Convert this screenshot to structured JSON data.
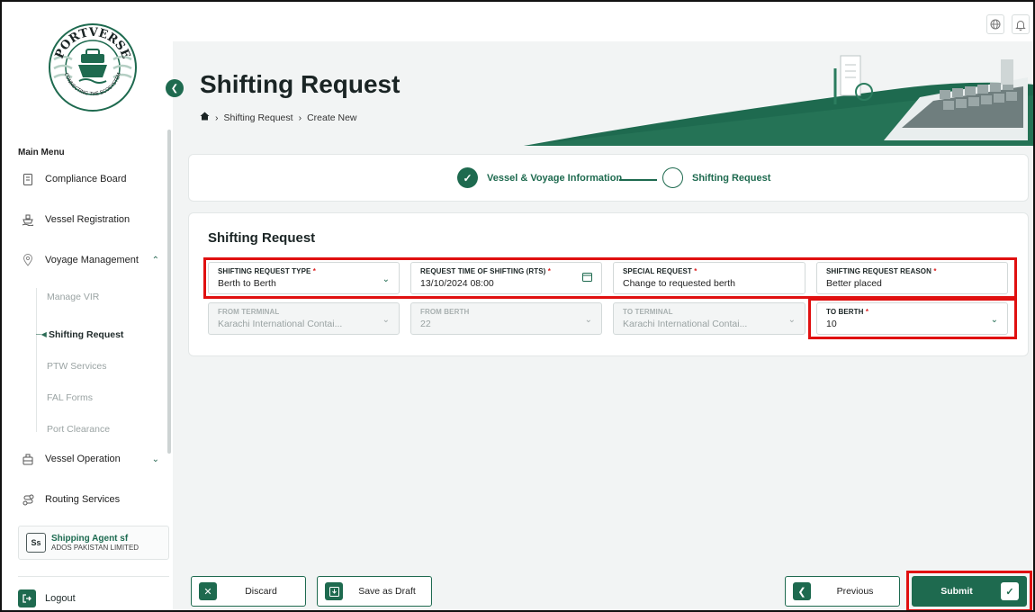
{
  "brand": {
    "name": "PORTVERSE",
    "tagline": "CONNECTING THE ECOSYSTEM"
  },
  "sidebar": {
    "main_menu_label": "Main Menu",
    "items": [
      {
        "label": "Compliance Board",
        "icon": "document-icon"
      },
      {
        "label": "Vessel Registration",
        "icon": "ship-icon"
      },
      {
        "label": "Voyage Management",
        "icon": "location-icon",
        "expanded": true
      },
      {
        "label": "Vessel Operation",
        "icon": "cargo-icon",
        "expanded": false
      },
      {
        "label": "Routing Services",
        "icon": "route-icon"
      }
    ],
    "sub_items": [
      "Manage VIR",
      "Shifting Request",
      "PTW Services",
      "FAL Forms",
      "Port Clearance"
    ],
    "active_sub_item": "Shifting Request",
    "user": {
      "initials": "Ss",
      "name": "Shipping Agent sf",
      "org": "ADOS PAKISTAN LIMITED"
    },
    "logout_label": "Logout"
  },
  "header": {
    "title": "Shifting Request",
    "breadcrumb": [
      "Shifting Request",
      "Create New"
    ]
  },
  "stepper": {
    "steps": [
      {
        "label": "Vessel & Voyage Information",
        "status": "done"
      },
      {
        "label": "Shifting Request",
        "status": "current"
      }
    ]
  },
  "form": {
    "title": "Shifting Request",
    "fields": {
      "shifting_request_type": {
        "label": "SHIFTING REQUEST TYPE",
        "required": "*",
        "value": "Berth to Berth"
      },
      "rts": {
        "label": "REQUEST TIME OF SHIFTING (RTS)",
        "required": "*",
        "value": "13/10/2024 08:00"
      },
      "special_request": {
        "label": "SPECIAL REQUEST",
        "required": "*",
        "value": "Change to requested berth"
      },
      "reason": {
        "label": "SHIFTING REQUEST REASON",
        "required": "*",
        "value": "Better placed"
      },
      "from_terminal": {
        "label": "FROM TERMINAL",
        "value": "Karachi International Contai..."
      },
      "from_berth": {
        "label": "FROM BERTH",
        "value": "22"
      },
      "to_terminal": {
        "label": "TO TERMINAL",
        "value": "Karachi International Contai..."
      },
      "to_berth": {
        "label": "TO BERTH",
        "required": "*",
        "value": "10"
      }
    }
  },
  "actions": {
    "discard": "Discard",
    "save_draft": "Save as Draft",
    "previous": "Previous",
    "submit": "Submit"
  },
  "colors": {
    "primary": "#1e6a4f",
    "highlight": "#e01010",
    "background": "#f2f4f4"
  }
}
